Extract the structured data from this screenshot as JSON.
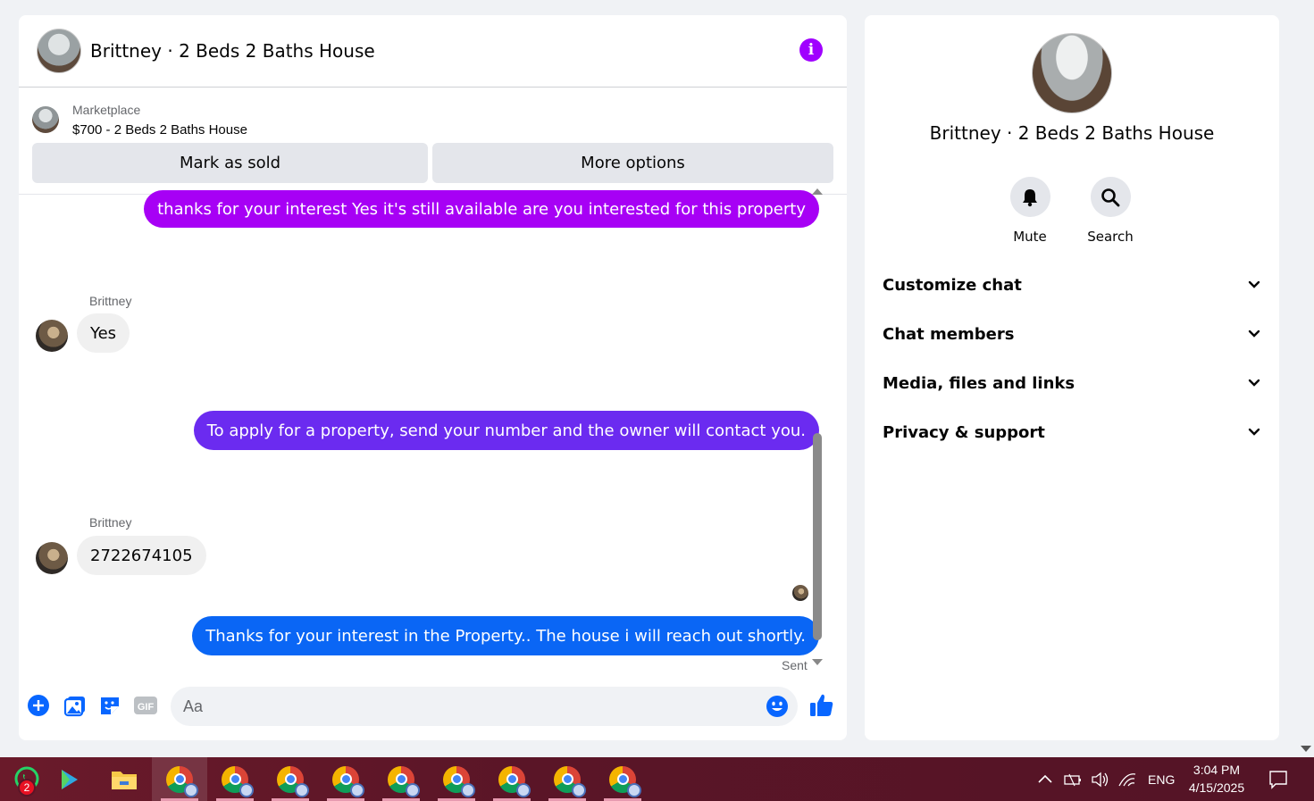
{
  "chat": {
    "title": "Brittney · 2 Beds 2 Baths House",
    "marketplace_label": "Marketplace",
    "listing": "$700 - 2 Beds 2 Baths House",
    "mark_sold": "Mark as sold",
    "more_options": "More options"
  },
  "messages": [
    {
      "from": "me",
      "text": "thanks for your interest Yes it's still available are you interested for this property"
    },
    {
      "from": "Brittney",
      "sender_label": "Brittney",
      "text": "Yes"
    },
    {
      "from": "me",
      "text": "To apply for a property, send your number and the owner will contact you."
    },
    {
      "from": "Brittney",
      "sender_label": "Brittney",
      "text": "2722674105"
    },
    {
      "from": "me",
      "text": "Thanks for your interest in the Property.. The house i will reach  out shortly."
    }
  ],
  "status": {
    "sent": "Sent"
  },
  "composer": {
    "placeholder": "Aa",
    "gif_label": "GIF"
  },
  "panel": {
    "title": "Brittney · 2 Beds 2 Baths House",
    "mute": "Mute",
    "search": "Search",
    "sections": [
      "Customize chat",
      "Chat members",
      "Media, files and links",
      "Privacy & support"
    ]
  },
  "taskbar": {
    "whatsapp_badge": "2",
    "language": "ENG",
    "time": "3:04 PM",
    "date": "4/15/2025"
  },
  "colors": {
    "accent_purple": "#a000ff",
    "bubble_purple": "#a700f5",
    "bubble_violet": "#6b2bf0",
    "bubble_blue": "#0a66f5",
    "messenger_blue": "#0866ff"
  }
}
